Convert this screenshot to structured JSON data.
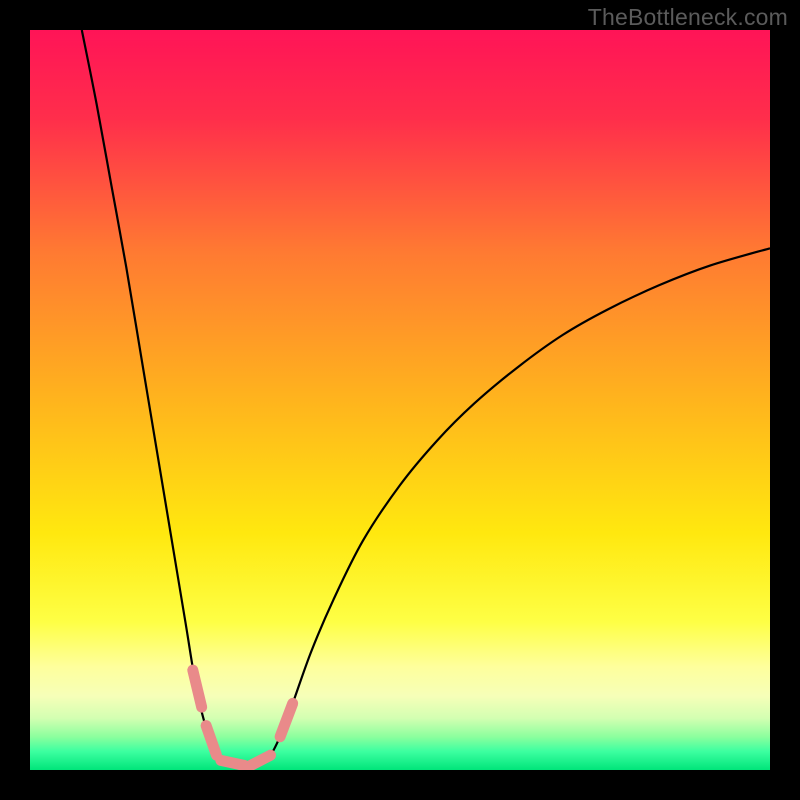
{
  "watermark": "TheBottleneck.com",
  "chart_data": {
    "type": "line",
    "title": "",
    "xlabel": "",
    "ylabel": "",
    "xlim": [
      0,
      100
    ],
    "ylim": [
      0,
      100
    ],
    "gradient_stops": [
      {
        "offset": 0.0,
        "color": "#ff1457"
      },
      {
        "offset": 0.12,
        "color": "#ff2e4b"
      },
      {
        "offset": 0.3,
        "color": "#ff7a32"
      },
      {
        "offset": 0.5,
        "color": "#ffb41d"
      },
      {
        "offset": 0.68,
        "color": "#ffe80f"
      },
      {
        "offset": 0.8,
        "color": "#feff45"
      },
      {
        "offset": 0.86,
        "color": "#feff9c"
      },
      {
        "offset": 0.9,
        "color": "#f6ffb8"
      },
      {
        "offset": 0.93,
        "color": "#d3ffb2"
      },
      {
        "offset": 0.955,
        "color": "#8cff9e"
      },
      {
        "offset": 0.975,
        "color": "#3cffa0"
      },
      {
        "offset": 1.0,
        "color": "#00e57a"
      }
    ],
    "series": [
      {
        "name": "bottleneck-curve",
        "description": "V-shaped curve; y≈100 at x≈7, falls to y≈0 near x≈25–32, rises back with decreasing slope to y≈70 at x≈100",
        "points": [
          {
            "x": 7,
            "y": 100
          },
          {
            "x": 9,
            "y": 90
          },
          {
            "x": 11,
            "y": 79
          },
          {
            "x": 13,
            "y": 68
          },
          {
            "x": 15,
            "y": 56
          },
          {
            "x": 17,
            "y": 44
          },
          {
            "x": 19,
            "y": 32
          },
          {
            "x": 21,
            "y": 20
          },
          {
            "x": 22.5,
            "y": 11
          },
          {
            "x": 24,
            "y": 5
          },
          {
            "x": 25.5,
            "y": 1.5
          },
          {
            "x": 27,
            "y": 0.5
          },
          {
            "x": 29,
            "y": 0.5
          },
          {
            "x": 31,
            "y": 0.8
          },
          {
            "x": 32.5,
            "y": 2
          },
          {
            "x": 34,
            "y": 5
          },
          {
            "x": 35.5,
            "y": 9
          },
          {
            "x": 38,
            "y": 16
          },
          {
            "x": 41,
            "y": 23
          },
          {
            "x": 45,
            "y": 31
          },
          {
            "x": 50,
            "y": 38.5
          },
          {
            "x": 55,
            "y": 44.5
          },
          {
            "x": 60,
            "y": 49.5
          },
          {
            "x": 66,
            "y": 54.5
          },
          {
            "x": 72,
            "y": 58.8
          },
          {
            "x": 78,
            "y": 62.2
          },
          {
            "x": 85,
            "y": 65.5
          },
          {
            "x": 92,
            "y": 68.2
          },
          {
            "x": 100,
            "y": 70.5
          }
        ]
      }
    ],
    "markers": {
      "name": "highlight-segments",
      "color": "#e98a8a",
      "stroke_width": 11,
      "segments": [
        {
          "x1": 22.0,
          "y1": 13.5,
          "x2": 23.2,
          "y2": 8.5
        },
        {
          "x1": 23.8,
          "y1": 6.0,
          "x2": 25.2,
          "y2": 2.0
        },
        {
          "x1": 25.8,
          "y1": 1.3,
          "x2": 29.0,
          "y2": 0.6
        },
        {
          "x1": 29.8,
          "y1": 0.6,
          "x2": 32.5,
          "y2": 2.0
        },
        {
          "x1": 33.8,
          "y1": 4.5,
          "x2": 35.5,
          "y2": 9.0
        }
      ]
    }
  }
}
